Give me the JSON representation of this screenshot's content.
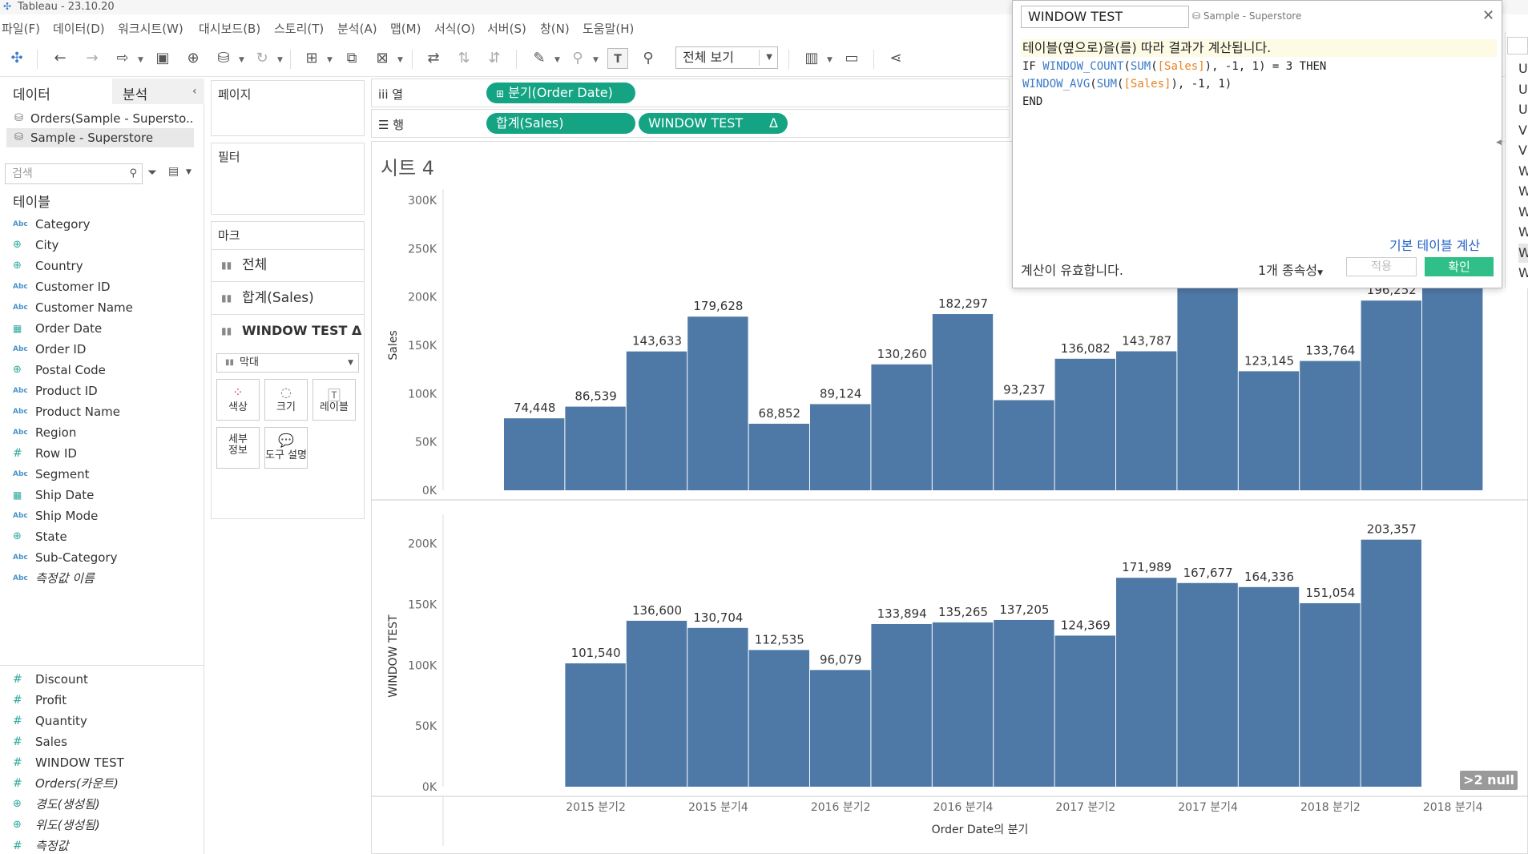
{
  "app": {
    "title": "Tableau - 23.10.20"
  },
  "menu": [
    "파일(F)",
    "데이터(D)",
    "워크시트(W)",
    "대시보드(B)",
    "스토리(T)",
    "분석(A)",
    "맵(M)",
    "서식(O)",
    "서버(S)",
    "창(N)",
    "도움말(H)"
  ],
  "toolbar": {
    "view_select": "전체 보기"
  },
  "data_pane": {
    "tab_data": "데이터",
    "tab_analysis": "분석",
    "datasources": [
      "Orders(Sample - Supersto...",
      "Sample - Superstore"
    ],
    "search_placeholder": "검색",
    "tables_heading": "테이블",
    "dimensions": [
      {
        "name": "Category",
        "icon": "abc"
      },
      {
        "name": "City",
        "icon": "globe"
      },
      {
        "name": "Country",
        "icon": "globe"
      },
      {
        "name": "Customer ID",
        "icon": "abc"
      },
      {
        "name": "Customer Name",
        "icon": "abc"
      },
      {
        "name": "Order Date",
        "icon": "calendar"
      },
      {
        "name": "Order ID",
        "icon": "abc"
      },
      {
        "name": "Postal Code",
        "icon": "globe"
      },
      {
        "name": "Product ID",
        "icon": "abc"
      },
      {
        "name": "Product Name",
        "icon": "abc"
      },
      {
        "name": "Region",
        "icon": "abc"
      },
      {
        "name": "Row ID",
        "icon": "hash"
      },
      {
        "name": "Segment",
        "icon": "abc"
      },
      {
        "name": "Ship Date",
        "icon": "calendar"
      },
      {
        "name": "Ship Mode",
        "icon": "abc"
      },
      {
        "name": "State",
        "icon": "globe"
      },
      {
        "name": "Sub-Category",
        "icon": "abc"
      },
      {
        "name": "측정값 이름",
        "icon": "abc",
        "italic": true
      }
    ],
    "measures": [
      {
        "name": "Discount",
        "icon": "hash"
      },
      {
        "name": "Profit",
        "icon": "hash"
      },
      {
        "name": "Quantity",
        "icon": "hash"
      },
      {
        "name": "Sales",
        "icon": "hash"
      },
      {
        "name": "WINDOW TEST",
        "icon": "hash"
      },
      {
        "name": "Orders(카운트)",
        "icon": "hash",
        "italic": true
      },
      {
        "name": "경도(생성됨)",
        "icon": "globe",
        "italic": true
      },
      {
        "name": "위도(생성됨)",
        "icon": "globe",
        "italic": true
      },
      {
        "name": "측정값",
        "icon": "hash",
        "italic": true
      }
    ]
  },
  "cards": {
    "pages": "페이지",
    "filters": "필터",
    "marks": "마크",
    "marks_rows": [
      "전체",
      "합계(Sales)",
      "WINDOW TEST"
    ],
    "mark_type": "막대",
    "mark_buttons": [
      "색상",
      "크기",
      "레이블",
      "세부\n정보",
      "도구 설명"
    ]
  },
  "shelves": {
    "columns_label": "열",
    "rows_label": "행",
    "columns_pills": [
      "분기(Order Date)"
    ],
    "rows_pills": [
      "합계(Sales)",
      "WINDOW TEST"
    ],
    "delta": "Δ"
  },
  "sheet": {
    "title": "시트 4"
  },
  "calc": {
    "name": "WINDOW TEST",
    "datasource": "Sample - Superstore",
    "message": "테이블(옆으로)을(를) 따라 결과가 계산됩니다.",
    "code_line1": "IF WINDOW_COUNT(SUM([Sales]), -1, 1) = 3 THEN",
    "code_line2": "WINDOW_AVG(SUM([Sales]), -1, 1)",
    "code_line3": "END",
    "link": "기본 테이블 계산",
    "valid": "계산이 유효합니다.",
    "deps": "1개 종속성",
    "apply": "적용",
    "ok": "확인"
  },
  "right_list": [
    "U",
    "U",
    "U",
    "V",
    "V",
    "W",
    "W",
    "W",
    "W",
    "W",
    "W"
  ],
  "null_badge": ">2 null",
  "chart_data": [
    {
      "type": "bar",
      "categories": [
        "2015 분기1",
        "2015 분기2",
        "2015 분기3",
        "2015 분기4",
        "2016 분기1",
        "2016 분기2",
        "2016 분기3",
        "2016 분기4",
        "2017 분기1",
        "2017 분기2",
        "2017 분기3",
        "2017 분기4",
        "2018 분기1",
        "2018 분기2",
        "2018 분기3",
        "2018 분기4"
      ],
      "values": [
        74448,
        86539,
        143633,
        179628,
        68852,
        89124,
        130260,
        182297,
        93237,
        136082,
        143787,
        265000,
        123145,
        133764,
        196252,
        280000
      ],
      "labels": [
        "74,448",
        "86,539",
        "143,633",
        "179,628",
        "68,852",
        "89,124",
        "130,260",
        "182,297",
        "93,237",
        "136,082",
        "143,787",
        "",
        "123,145",
        "133,764",
        "196,252",
        ""
      ],
      "ylabel": "Sales",
      "ylim": [
        0,
        300000
      ],
      "yticks": [
        "0K",
        "50K",
        "100K",
        "150K",
        "200K",
        "250K",
        "300K"
      ],
      "color": "#4e79a7"
    },
    {
      "type": "bar",
      "categories": [
        "2015 분기1",
        "2015 분기2",
        "2015 분기3",
        "2015 분기4",
        "2016 분기1",
        "2016 분기2",
        "2016 분기3",
        "2016 분기4",
        "2017 분기1",
        "2017 분기2",
        "2017 분기3",
        "2017 분기4",
        "2018 분기1",
        "2018 분기2",
        "2018 분기3",
        "2018 분기4"
      ],
      "values": [
        null,
        101540,
        136600,
        130704,
        112535,
        96079,
        133894,
        135265,
        137205,
        124369,
        171989,
        167677,
        164336,
        151054,
        203357,
        null
      ],
      "labels": [
        "",
        "101,540",
        "136,600",
        "130,704",
        "112,535",
        "96,079",
        "133,894",
        "135,265",
        "137,205",
        "124,369",
        "171,989",
        "167,677",
        "164,336",
        "151,054",
        "203,357",
        ""
      ],
      "ylabel": "WINDOW TEST",
      "ylim": [
        0,
        215000
      ],
      "yticks": [
        "0K",
        "50K",
        "100K",
        "150K",
        "200K"
      ],
      "color": "#4e79a7"
    }
  ],
  "x_axis": {
    "title": "Order Date의 분기",
    "ticks": [
      "2015 분기2",
      "2015 분기4",
      "2016 분기2",
      "2016 분기4",
      "2017 분기2",
      "2017 분기4",
      "2018 분기2",
      "2018 분기4"
    ]
  }
}
